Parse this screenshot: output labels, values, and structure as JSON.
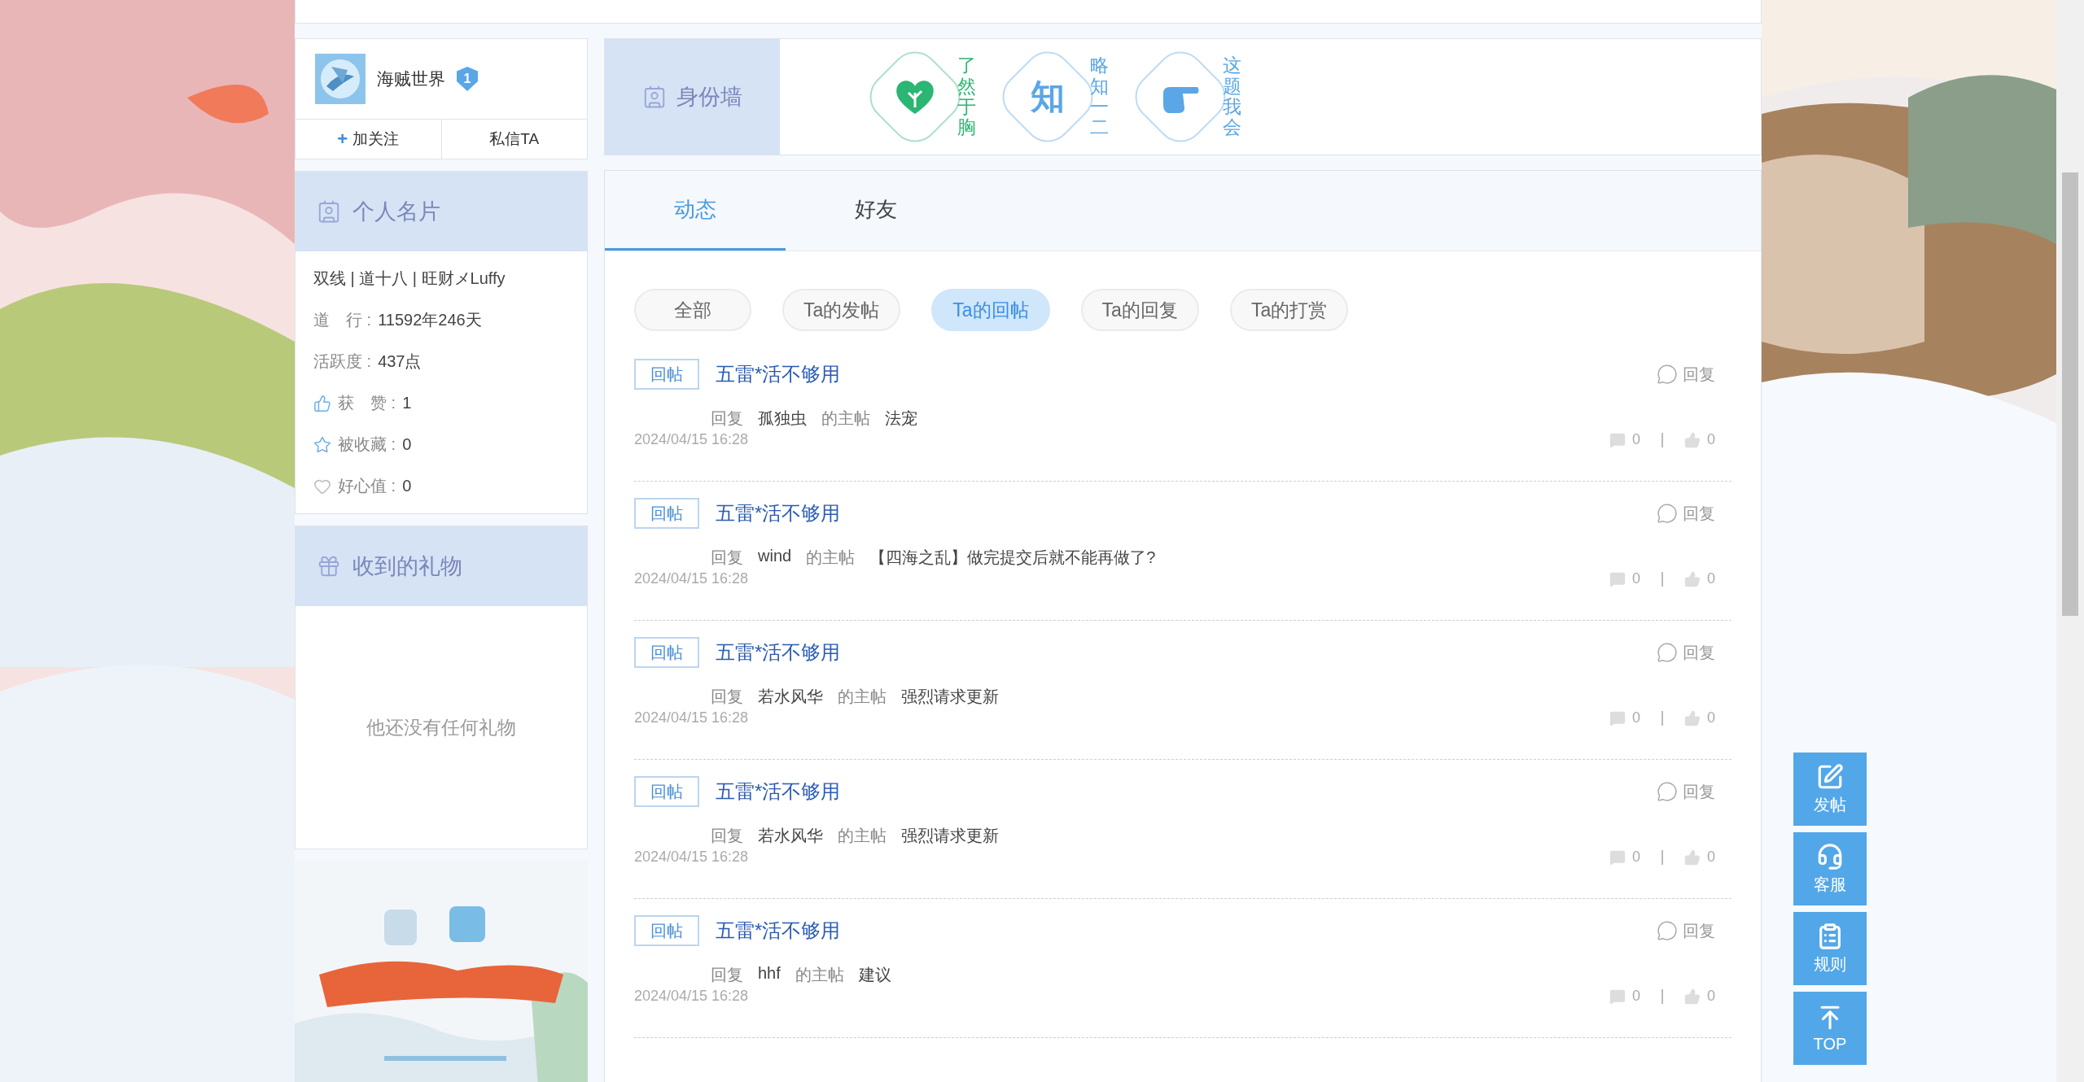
{
  "profile": {
    "name": "海贼世界",
    "level": "1",
    "actions": [
      {
        "icon": "+",
        "label": "加关注"
      },
      {
        "label": "私信TA"
      }
    ]
  },
  "card": {
    "title": "个人名片",
    "line": "双线 | 道十八 | 旺财メLuffy",
    "stats": [
      {
        "label": "道　行 :",
        "value": "11592年246天"
      },
      {
        "label": "活跃度 :",
        "value": "437点"
      }
    ],
    "counters": [
      {
        "kind": "like",
        "label": "获　赞 :",
        "value": "1"
      },
      {
        "kind": "star",
        "label": "被收藏 :",
        "value": "0"
      },
      {
        "kind": "heart",
        "label": "好心值 :",
        "value": "0"
      }
    ]
  },
  "gifts": {
    "title": "收到的礼物",
    "empty": "他还没有任何礼物"
  },
  "identity_wall": {
    "title": "身份墙",
    "badges": [
      {
        "kind": "plant",
        "label": "了然于胸",
        "color": "#2bb673"
      },
      {
        "kind": "glyph",
        "glyph": "知",
        "label": "略知一二",
        "color": "#5aa6e6"
      },
      {
        "kind": "hand",
        "label": "这题我会",
        "color": "#5aa6e6"
      }
    ]
  },
  "tabs": [
    {
      "label": "动态",
      "selected": true
    },
    {
      "label": "好友",
      "selected": false
    }
  ],
  "filters": [
    {
      "label": "全部",
      "selected": false
    },
    {
      "label": "Ta的发帖",
      "selected": false
    },
    {
      "label": "Ta的回帖",
      "selected": true
    },
    {
      "label": "Ta的回复",
      "selected": false
    },
    {
      "label": "Ta的打赏",
      "selected": false
    }
  ],
  "posts": [
    {
      "tag": "回帖",
      "title": "五雷*活不够用",
      "reply": "回复",
      "verb": "回复",
      "user": "孤独虫",
      "middle": "的主帖",
      "topic": "法宠",
      "date": "2024/04/15 16:28",
      "comments": "0",
      "likes": "0"
    },
    {
      "tag": "回帖",
      "title": "五雷*活不够用",
      "reply": "回复",
      "verb": "回复",
      "user": "wind",
      "middle": "的主帖",
      "topic": "【四海之乱】做完提交后就不能再做了?",
      "date": "2024/04/15 16:28",
      "comments": "0",
      "likes": "0"
    },
    {
      "tag": "回帖",
      "title": "五雷*活不够用",
      "reply": "回复",
      "verb": "回复",
      "user": "若水风华",
      "middle": "的主帖",
      "topic": "强烈请求更新",
      "date": "2024/04/15 16:28",
      "comments": "0",
      "likes": "0"
    },
    {
      "tag": "回帖",
      "title": "五雷*活不够用",
      "reply": "回复",
      "verb": "回复",
      "user": "若水风华",
      "middle": "的主帖",
      "topic": "强烈请求更新",
      "date": "2024/04/15 16:28",
      "comments": "0",
      "likes": "0"
    },
    {
      "tag": "回帖",
      "title": "五雷*活不够用",
      "reply": "回复",
      "verb": "回复",
      "user": "hhf",
      "middle": "的主帖",
      "topic": "建议",
      "date": "2024/04/15 16:28",
      "comments": "0",
      "likes": "0"
    }
  ],
  "float_buttons": [
    {
      "kind": "edit",
      "label": "发帖"
    },
    {
      "kind": "service",
      "label": "客服"
    },
    {
      "kind": "rules",
      "label": "规则"
    },
    {
      "kind": "top",
      "label": "TOP"
    }
  ]
}
